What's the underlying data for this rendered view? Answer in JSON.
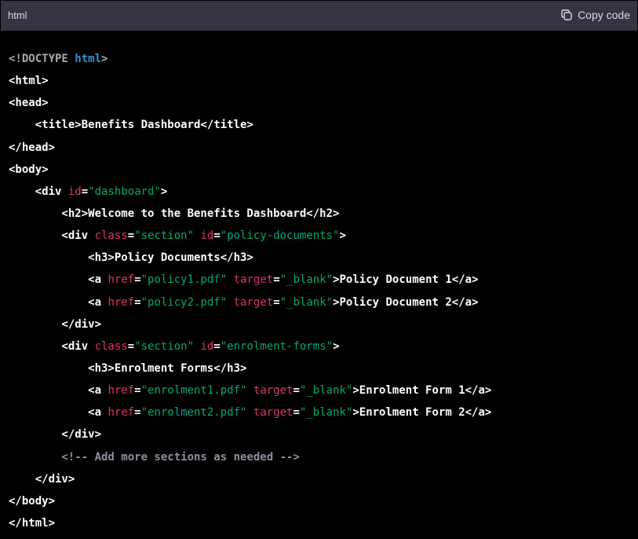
{
  "header": {
    "language": "html",
    "copy_label": "Copy code"
  },
  "colors": {
    "header_bg": "#343541",
    "code_bg": "#000000",
    "plain": "#ffffff",
    "attr": "#df3079",
    "string": "#00a67d",
    "keyword": "#2e95d3",
    "comment": "#8e8ea0"
  },
  "icons": {
    "copy": "copy-icon"
  },
  "code": {
    "lines": [
      [
        {
          "t": "doctype",
          "v": "<!DOCTYPE "
        },
        {
          "t": "keyword",
          "v": "html"
        },
        {
          "t": "doctype",
          "v": ">"
        }
      ],
      [
        {
          "t": "plain",
          "v": "<html>"
        }
      ],
      [
        {
          "t": "plain",
          "v": "<head>"
        }
      ],
      [
        {
          "t": "plain",
          "v": "    <title>Benefits Dashboard</title>"
        }
      ],
      [
        {
          "t": "plain",
          "v": "</head>"
        }
      ],
      [
        {
          "t": "plain",
          "v": "<body>"
        }
      ],
      [
        {
          "t": "plain",
          "v": "    <div "
        },
        {
          "t": "attr",
          "v": "id"
        },
        {
          "t": "plain",
          "v": "="
        },
        {
          "t": "string",
          "v": "\"dashboard\""
        },
        {
          "t": "plain",
          "v": ">"
        }
      ],
      [
        {
          "t": "plain",
          "v": "        <h2>Welcome to the Benefits Dashboard</h2>"
        }
      ],
      [
        {
          "t": "plain",
          "v": "        <div "
        },
        {
          "t": "attr",
          "v": "class"
        },
        {
          "t": "plain",
          "v": "="
        },
        {
          "t": "string",
          "v": "\"section\""
        },
        {
          "t": "plain",
          "v": " "
        },
        {
          "t": "attr",
          "v": "id"
        },
        {
          "t": "plain",
          "v": "="
        },
        {
          "t": "string",
          "v": "\"policy-documents\""
        },
        {
          "t": "plain",
          "v": ">"
        }
      ],
      [
        {
          "t": "plain",
          "v": "            <h3>Policy Documents</h3>"
        }
      ],
      [
        {
          "t": "plain",
          "v": "            <a "
        },
        {
          "t": "attr",
          "v": "href"
        },
        {
          "t": "plain",
          "v": "="
        },
        {
          "t": "string",
          "v": "\"policy1.pdf\""
        },
        {
          "t": "plain",
          "v": " "
        },
        {
          "t": "attr",
          "v": "target"
        },
        {
          "t": "plain",
          "v": "="
        },
        {
          "t": "string",
          "v": "\"_blank\""
        },
        {
          "t": "plain",
          "v": ">Policy Document 1</a>"
        }
      ],
      [
        {
          "t": "plain",
          "v": "            <a "
        },
        {
          "t": "attr",
          "v": "href"
        },
        {
          "t": "plain",
          "v": "="
        },
        {
          "t": "string",
          "v": "\"policy2.pdf\""
        },
        {
          "t": "plain",
          "v": " "
        },
        {
          "t": "attr",
          "v": "target"
        },
        {
          "t": "plain",
          "v": "="
        },
        {
          "t": "string",
          "v": "\"_blank\""
        },
        {
          "t": "plain",
          "v": ">Policy Document 2</a>"
        }
      ],
      [
        {
          "t": "plain",
          "v": "        </div>"
        }
      ],
      [
        {
          "t": "plain",
          "v": "        <div "
        },
        {
          "t": "attr",
          "v": "class"
        },
        {
          "t": "plain",
          "v": "="
        },
        {
          "t": "string",
          "v": "\"section\""
        },
        {
          "t": "plain",
          "v": " "
        },
        {
          "t": "attr",
          "v": "id"
        },
        {
          "t": "plain",
          "v": "="
        },
        {
          "t": "string",
          "v": "\"enrolment-forms\""
        },
        {
          "t": "plain",
          "v": ">"
        }
      ],
      [
        {
          "t": "plain",
          "v": "            <h3>Enrolment Forms</h3>"
        }
      ],
      [
        {
          "t": "plain",
          "v": "            <a "
        },
        {
          "t": "attr",
          "v": "href"
        },
        {
          "t": "plain",
          "v": "="
        },
        {
          "t": "string",
          "v": "\"enrolment1.pdf\""
        },
        {
          "t": "plain",
          "v": " "
        },
        {
          "t": "attr",
          "v": "target"
        },
        {
          "t": "plain",
          "v": "="
        },
        {
          "t": "string",
          "v": "\"_blank\""
        },
        {
          "t": "plain",
          "v": ">Enrolment Form 1</a>"
        }
      ],
      [
        {
          "t": "plain",
          "v": "            <a "
        },
        {
          "t": "attr",
          "v": "href"
        },
        {
          "t": "plain",
          "v": "="
        },
        {
          "t": "string",
          "v": "\"enrolment2.pdf\""
        },
        {
          "t": "plain",
          "v": " "
        },
        {
          "t": "attr",
          "v": "target"
        },
        {
          "t": "plain",
          "v": "="
        },
        {
          "t": "string",
          "v": "\"_blank\""
        },
        {
          "t": "plain",
          "v": ">Enrolment Form 2</a>"
        }
      ],
      [
        {
          "t": "plain",
          "v": "        </div>"
        }
      ],
      [
        {
          "t": "comment",
          "v": "        <!-- Add more sections as needed -->"
        }
      ],
      [
        {
          "t": "plain",
          "v": "    </div>"
        }
      ],
      [
        {
          "t": "plain",
          "v": "</body>"
        }
      ],
      [
        {
          "t": "plain",
          "v": "</html>"
        }
      ]
    ]
  }
}
